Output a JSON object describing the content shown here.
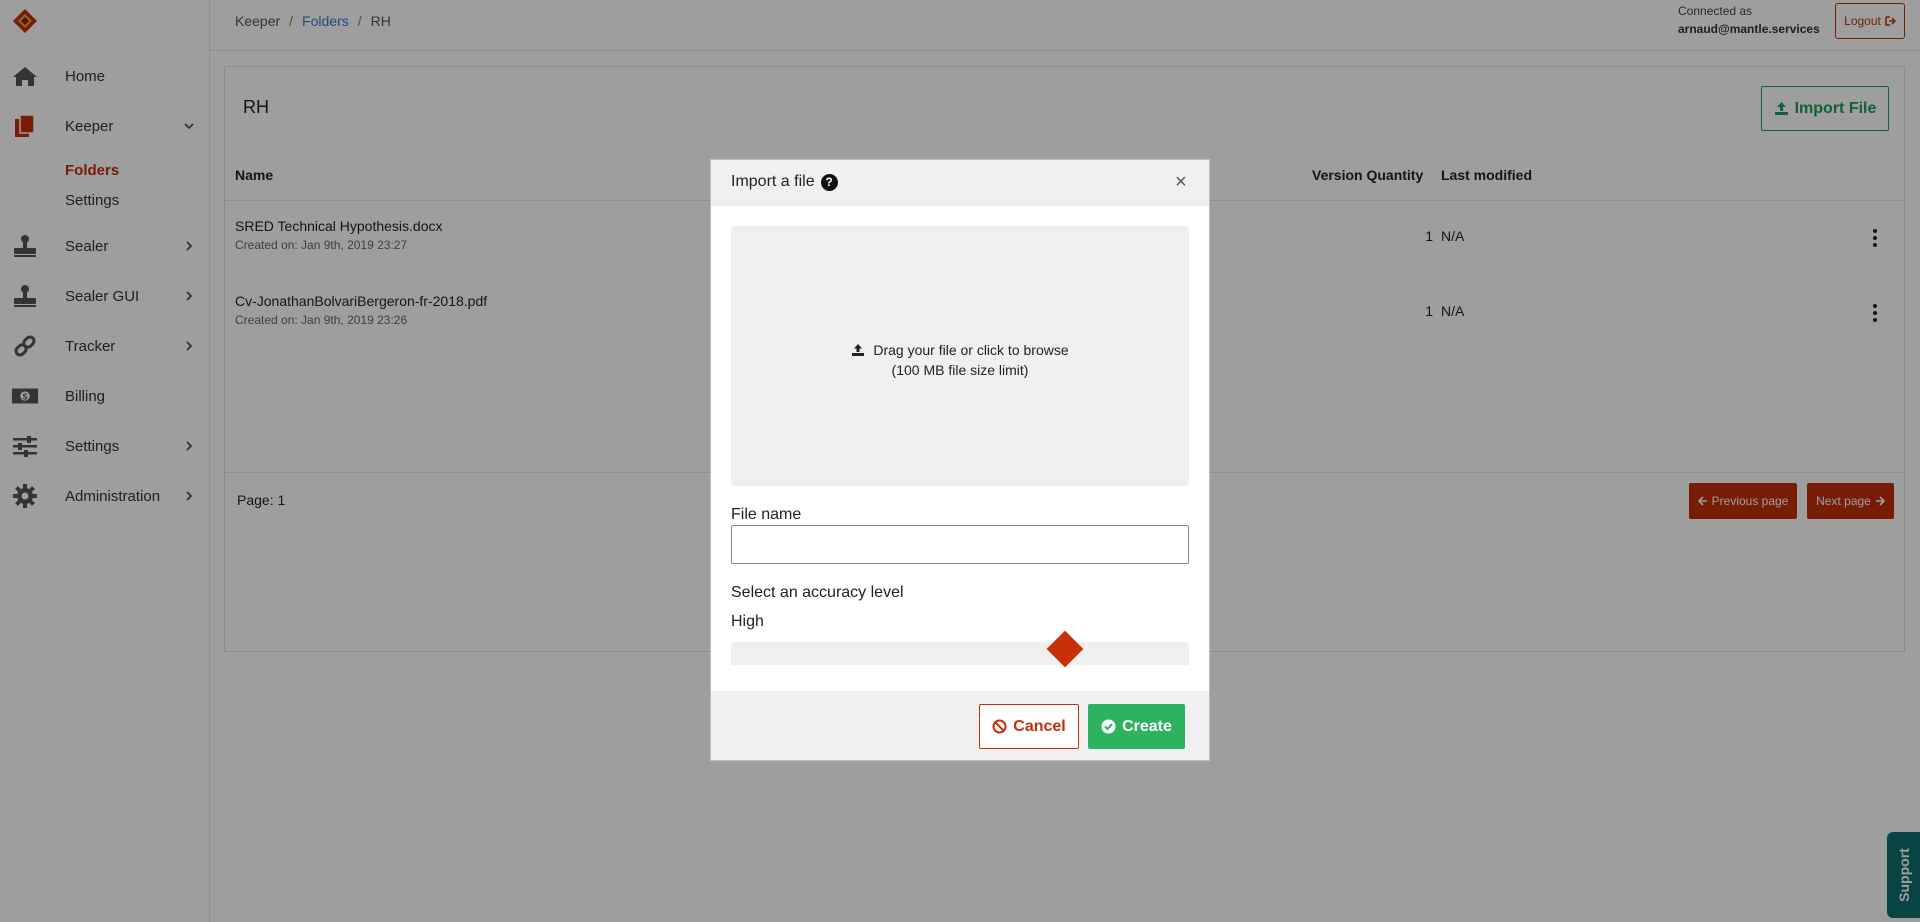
{
  "sidebar": {
    "items": [
      {
        "label": "Home",
        "icon": "home-icon"
      },
      {
        "label": "Keeper",
        "icon": "documents-icon",
        "active": true
      },
      {
        "label": "Sealer",
        "icon": "stamp-icon"
      },
      {
        "label": "Sealer GUI",
        "icon": "stamp-icon"
      },
      {
        "label": "Tracker",
        "icon": "link-icon"
      },
      {
        "label": "Billing",
        "icon": "money-icon"
      },
      {
        "label": "Settings",
        "icon": "sliders-icon"
      },
      {
        "label": "Administration",
        "icon": "gear-icon"
      }
    ],
    "keeper_sub": [
      {
        "label": "Folders",
        "active": true
      },
      {
        "label": "Settings"
      }
    ]
  },
  "breadcrumb": [
    "Keeper",
    "Folders",
    "RH"
  ],
  "header": {
    "connected_label": "Connected as",
    "user": "arnaud@mantle.services",
    "logout_label": "Logout"
  },
  "panel": {
    "title": "RH",
    "import_label": "Import File",
    "columns": {
      "name": "Name",
      "version_quantity": "Version Quantity",
      "last_modified": "Last modified"
    },
    "files": [
      {
        "name": "SRED Technical Hypothesis.docx",
        "created": "Created on: Jan 9th, 2019 23:27",
        "versions": "1",
        "last_modified": "N/A"
      },
      {
        "name": "Cv-JonathanBolvariBergeron-fr-2018.pdf",
        "created": "Created on: Jan 9th, 2019 23:26",
        "versions": "1",
        "last_modified": "N/A"
      }
    ],
    "page_label": "Page: 1",
    "prev_label": "Previous page",
    "next_label": "Next page"
  },
  "modal": {
    "title": "Import a file",
    "drop_text": "Drag your file or click to browse",
    "drop_limit": "(100 MB file size limit)",
    "file_name_label": "File name",
    "file_name_value": "",
    "accuracy_label": "Select an accuracy level",
    "accuracy_value": "High",
    "accuracy_level_fraction": 0.73,
    "cancel_label": "Cancel",
    "create_label": "Create"
  },
  "support_label": "Support",
  "colors": {
    "accent": "#c0300b",
    "success": "#2db35f",
    "link": "#2a7bd6",
    "support": "#0d6e6e"
  }
}
